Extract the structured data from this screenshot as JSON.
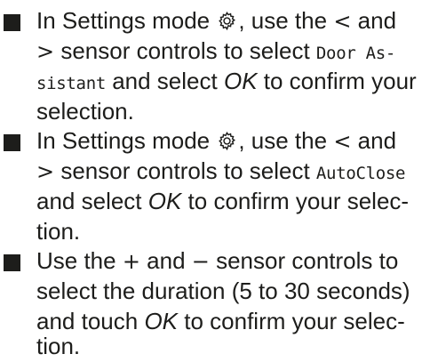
{
  "items": [
    {
      "lines": [
        {
          "pre": "In Settings mode ",
          "post": ", use the ",
          "sym": "<",
          "tail": " and"
        },
        {
          "sym": ">",
          "pre": " sensor controls to select ",
          "display": "Door As-"
        },
        {
          "display": "sistant",
          "mid": " and select ",
          "em": "OK",
          "tail": " to confirm your"
        },
        {
          "text": "selection."
        }
      ]
    },
    {
      "lines": [
        {
          "pre": "In Settings mode ",
          "post": ", use the ",
          "sym": "<",
          "tail": " and"
        },
        {
          "sym": ">",
          "pre": " sensor controls to select ",
          "display": "AutoClose"
        },
        {
          "text": "and select ",
          "em": "OK",
          "tail": " to confirm your selec-"
        },
        {
          "text": "tion."
        }
      ]
    },
    {
      "lines": [
        {
          "pre": "Use the ",
          "sym": "+",
          "mid": " and ",
          "sym2": "−",
          "tail": " sensor controls to"
        },
        {
          "text": "select the duration (5 to 30 seconds)"
        },
        {
          "text": "and touch ",
          "em": "OK",
          "tail": " to confirm your selec-"
        },
        {
          "text": "tion."
        }
      ]
    }
  ],
  "icons": {
    "settings": "gear-icon",
    "bullet": "square-bullet-icon"
  }
}
